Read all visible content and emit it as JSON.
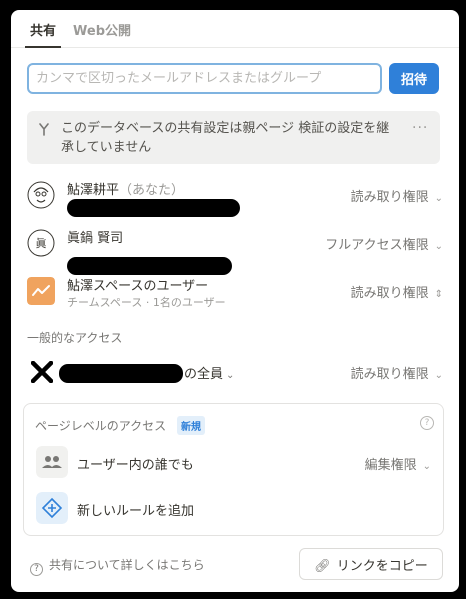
{
  "tabs": {
    "share": "共有",
    "publish": "Web公開"
  },
  "invite": {
    "placeholder": "カンマで区切ったメールアドレスまたはグループ",
    "button": "招待"
  },
  "notice": {
    "text": "このデータベースの共有設定は親ページ 検証の設定を継承していません",
    "more": "···"
  },
  "members": [
    {
      "name": "鮎澤耕平",
      "you": "（あなた）",
      "permission": "読み取り権限"
    },
    {
      "name": "眞鍋 賢司",
      "permission": "フルアクセス権限"
    },
    {
      "name": "鮎澤スペースのユーザー",
      "subtitle": "チームスペース · 1名のユーザー",
      "permission": "読み取り権限"
    }
  ],
  "general": {
    "label": "一般的なアクセス",
    "suffix": "の全員",
    "permission": "読み取り権限"
  },
  "page_level": {
    "title": "ページレベルのアクセス",
    "badge": "新規",
    "help": "?",
    "rule": {
      "label": "ユーザー内の誰でも",
      "permission": "編集権限"
    },
    "add_rule": "新しいルールを追加"
  },
  "footer": {
    "help": "共有について詳しくはこちら",
    "copy": "リンクをコピー"
  },
  "colors": {
    "accent": "#2f80d9",
    "badge_bg": "#e3effa",
    "teamspace_icon": "#f0a35e"
  }
}
